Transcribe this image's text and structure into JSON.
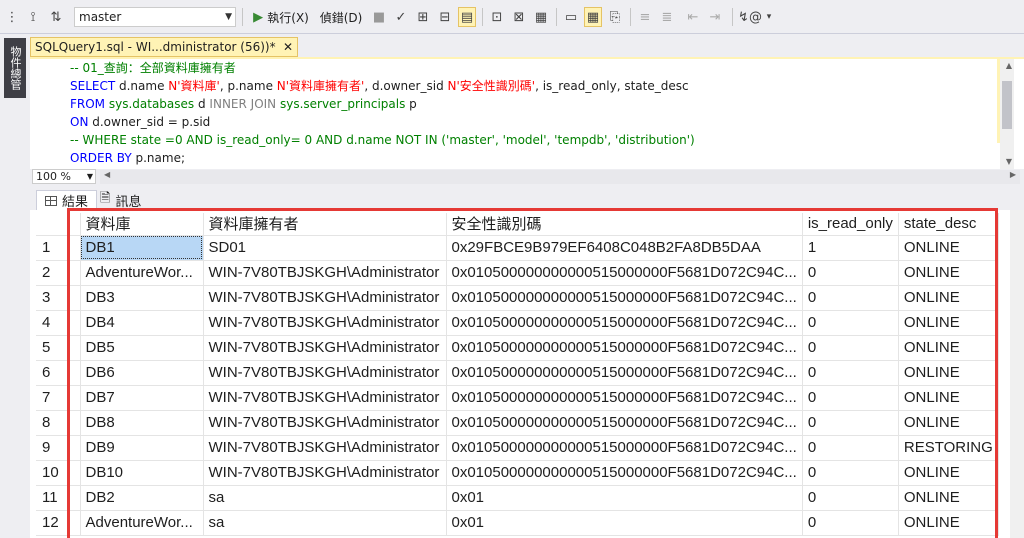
{
  "toolbar": {
    "database": "master",
    "execute_label": "執行(X)",
    "debug_label": "偵錯(D)"
  },
  "side_tab": {
    "label": "物件總管"
  },
  "doc_tab": {
    "title": "SQLQuery1.sql - WI...dministrator (56))*",
    "close": "✕"
  },
  "editor": {
    "line1_comment": "-- 01_查詢：全部資料庫擁有者",
    "line2": {
      "select": "SELECT",
      "a": " d.name ",
      "s1": "N'資料庫'",
      "b": ", p.name ",
      "s2": "N'資料庫擁有者'",
      "c": ", d.owner_sid ",
      "s3": "N'安全性識別碼'",
      "d": ", is_read_only, state_desc"
    },
    "line3": {
      "from": "FROM",
      "t1": " sys.databases ",
      "a1": "d ",
      "join": "INNER JOIN",
      "t2": " sys.server_principals ",
      "a2": "p"
    },
    "line4": {
      "on": "ON",
      "cond": " d.owner_sid = p.sid"
    },
    "line5_comment": "-- WHERE state =0 AND is_read_only= 0 AND d.name NOT IN ('master', 'model', 'tempdb', 'distribution')",
    "line6": {
      "order": "ORDER BY",
      "col": " p.name;"
    }
  },
  "zoom": {
    "value": "100 %"
  },
  "results_tabs": {
    "results": "結果",
    "messages": "訊息"
  },
  "grid": {
    "columns": [
      "資料庫",
      "資料庫擁有者",
      "安全性識別碼",
      "is_read_only",
      "state_desc"
    ],
    "rows": [
      [
        "1",
        "DB1",
        "SD01",
        "0x29FBCE9B979EF6408C048B2FA8DB5DAA",
        "1",
        "ONLINE"
      ],
      [
        "2",
        "AdventureWor...",
        "WIN-7V80TBJSKGH\\Administrator",
        "0x010500000000000515000000F5681D072C94C...",
        "0",
        "ONLINE"
      ],
      [
        "3",
        "DB3",
        "WIN-7V80TBJSKGH\\Administrator",
        "0x010500000000000515000000F5681D072C94C...",
        "0",
        "ONLINE"
      ],
      [
        "4",
        "DB4",
        "WIN-7V80TBJSKGH\\Administrator",
        "0x010500000000000515000000F5681D072C94C...",
        "0",
        "ONLINE"
      ],
      [
        "5",
        "DB5",
        "WIN-7V80TBJSKGH\\Administrator",
        "0x010500000000000515000000F5681D072C94C...",
        "0",
        "ONLINE"
      ],
      [
        "6",
        "DB6",
        "WIN-7V80TBJSKGH\\Administrator",
        "0x010500000000000515000000F5681D072C94C...",
        "0",
        "ONLINE"
      ],
      [
        "7",
        "DB7",
        "WIN-7V80TBJSKGH\\Administrator",
        "0x010500000000000515000000F5681D072C94C...",
        "0",
        "ONLINE"
      ],
      [
        "8",
        "DB8",
        "WIN-7V80TBJSKGH\\Administrator",
        "0x010500000000000515000000F5681D072C94C...",
        "0",
        "ONLINE"
      ],
      [
        "9",
        "DB9",
        "WIN-7V80TBJSKGH\\Administrator",
        "0x010500000000000515000000F5681D072C94C...",
        "0",
        "RESTORING"
      ],
      [
        "10",
        "DB10",
        "WIN-7V80TBJSKGH\\Administrator",
        "0x010500000000000515000000F5681D072C94C...",
        "0",
        "ONLINE"
      ],
      [
        "11",
        "DB2",
        "sa",
        "0x01",
        "0",
        "ONLINE"
      ],
      [
        "12",
        "AdventureWor...",
        "sa",
        "0x01",
        "0",
        "ONLINE"
      ]
    ]
  },
  "colors": {
    "highlight_frame": "#e53935",
    "selected_cell": "#b8d7f5",
    "tab_active": "#fff3b5"
  }
}
